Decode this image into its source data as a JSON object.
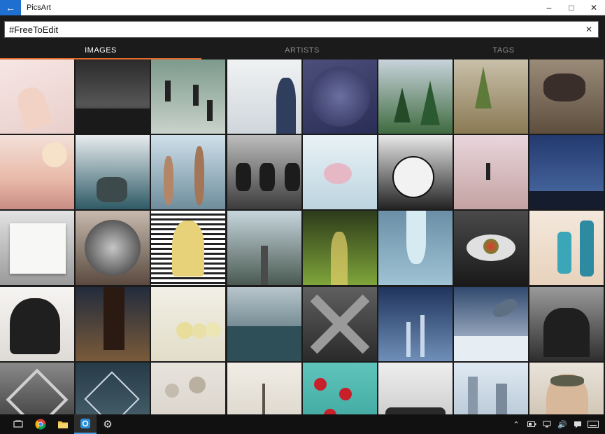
{
  "window": {
    "title": "PicsArt",
    "back_icon": "back-arrow-icon",
    "controls": [
      "minimize-icon",
      "maximize-icon",
      "close-icon"
    ]
  },
  "search": {
    "value": "#FreeToEdit",
    "clear_icon": "clear-icon"
  },
  "tabs": [
    {
      "label": "IMAGES",
      "active": true
    },
    {
      "label": "ARTISTS",
      "active": false
    },
    {
      "label": "TAGS",
      "active": false
    }
  ],
  "accent_color": "#e06a2c",
  "grid": {
    "columns": 8,
    "tiles": [
      {
        "bg": "linear-gradient(160deg,#f6e6e4,#e9cfcb)",
        "fx": "hands"
      },
      {
        "bg": "linear-gradient(180deg,#2b2b2b,#555 60%,#222)",
        "fx": "stars"
      },
      {
        "bg": "linear-gradient(180deg,#7d9a8c,#c9d3cc)",
        "fx": "people"
      },
      {
        "bg": "linear-gradient(180deg,#f0f2f3,#cfd6db)",
        "fx": "girl"
      },
      {
        "bg": "linear-gradient(160deg,#4c4f7a,#2a2d55)",
        "fx": "leaves"
      },
      {
        "bg": "linear-gradient(180deg,#c8d3dc,#3f6b3f)",
        "fx": "pines"
      },
      {
        "bg": "linear-gradient(180deg,#c9c0aa,#8a7a54)",
        "fx": "forest"
      },
      {
        "bg": "linear-gradient(180deg,#9a8a78,#5e4e3e)",
        "fx": "couple"
      },
      {
        "bg": "linear-gradient(180deg,#f3e0d8,#e8b9a8 60%,#c98c84)",
        "fx": "moon"
      },
      {
        "bg": "linear-gradient(180deg,#e8ecef,#2e5a66)",
        "fx": "hand"
      },
      {
        "bg": "linear-gradient(180deg,#cfe0ea,#6e8d9c)",
        "fx": "swimmers"
      },
      {
        "bg": "linear-gradient(180deg,#bdbdbd,#3c3c3c)",
        "fx": "bikes"
      },
      {
        "bg": "linear-gradient(180deg,#e9f2f6,#bcd4df)",
        "fx": "sketch"
      },
      {
        "bg": "linear-gradient(180deg,#e8e8e8,#222)",
        "fx": "drawing"
      },
      {
        "bg": "linear-gradient(180deg,#e8d6dc,#c4a2a2)",
        "fx": "walker"
      },
      {
        "bg": "linear-gradient(180deg,#233a6e,#4d6fa8)",
        "fx": "night"
      },
      {
        "bg": "linear-gradient(180deg,#e2e2e2,#9a9a9a)",
        "fx": "notebook"
      },
      {
        "bg": "linear-gradient(180deg,#c7b9ad,#5a4a3f)",
        "fx": "circle"
      },
      {
        "bg": "repeating-linear-gradient(180deg,#fff 0 4px,#222 4px 7px)",
        "fx": "face"
      },
      {
        "bg": "linear-gradient(180deg,#c7d6dd,#4a5a52)",
        "fx": "road"
      },
      {
        "bg": "linear-gradient(180deg,#2c3a1a,#7fa53a)",
        "fx": "bamboo"
      },
      {
        "bg": "linear-gradient(180deg,#6a8fa6,#9fc3d4)",
        "fx": "splash"
      },
      {
        "bg": "linear-gradient(180deg,#4a4a4a,#1a1a1a)",
        "fx": "eye"
      },
      {
        "bg": "linear-gradient(180deg,#f3e8dc,#e8d2bc)",
        "fx": "bottles"
      },
      {
        "bg": "linear-gradient(180deg,#f6f4f2,#dedad6)",
        "fx": "silhouette"
      },
      {
        "bg": "linear-gradient(180deg,#232c3c,#7a5a3a)",
        "fx": "legs"
      },
      {
        "bg": "linear-gradient(180deg,#f1efe6,#e2ddc8)",
        "fx": "apples"
      },
      {
        "bg": "linear-gradient(180deg,#b8c6cc,#3e5a63)",
        "fx": "sea"
      },
      {
        "bg": "linear-gradient(180deg,#5f5f5f,#2a2a2a)",
        "fx": "city"
      },
      {
        "bg": "linear-gradient(180deg,#20345c,#6f8fb8)",
        "fx": "plants"
      },
      {
        "bg": "linear-gradient(180deg,#31496e,#c6d4e2)",
        "fx": "whale"
      },
      {
        "bg": "linear-gradient(180deg,#9a9a9a,#2e2e2e)",
        "fx": "trees"
      },
      {
        "bg": "linear-gradient(180deg,#8a8a8a,#2e2e2e)",
        "fx": "building"
      },
      {
        "bg": "linear-gradient(180deg,#263b47,#4e6874)",
        "fx": "triangle"
      },
      {
        "bg": "linear-gradient(180deg,#e7e3dd,#d6d0c6)",
        "fx": "flowers"
      },
      {
        "bg": "linear-gradient(180deg,#f1ede6,#d8d2c6)",
        "fx": "tree"
      },
      {
        "bg": "linear-gradient(180deg,#5fc4bc,#3aa39b)",
        "fx": "balls"
      },
      {
        "bg": "linear-gradient(180deg,#eeeeee,#c2c2c2)",
        "fx": "group"
      },
      {
        "bg": "linear-gradient(180deg,#dfe9f2,#aebfcf)",
        "fx": "towers"
      },
      {
        "bg": "linear-gradient(180deg,#e9e3da,#c7bba8)",
        "fx": "pilot"
      }
    ]
  },
  "taskbar": {
    "apps": [
      "task-view-icon",
      "chrome-icon",
      "file-explorer-icon",
      "picsart-icon",
      "settings-icon"
    ],
    "tray": [
      "chevron-up-icon",
      "battery-icon",
      "network-icon",
      "volume-icon",
      "notification-icon",
      "keyboard-icon"
    ]
  }
}
